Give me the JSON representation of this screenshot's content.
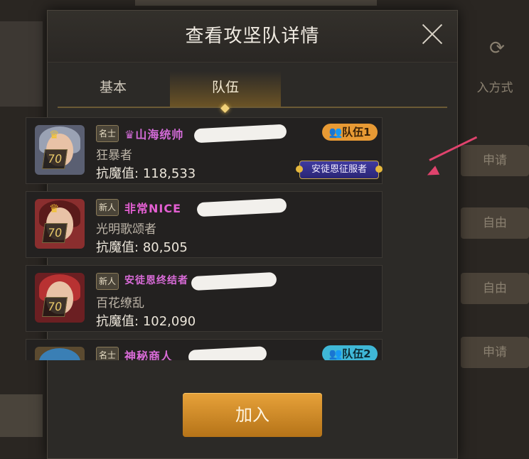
{
  "modal": {
    "title": "查看攻坚队详情",
    "tabs": [
      {
        "label": "基本",
        "active": false
      },
      {
        "label": "队伍",
        "active": true
      }
    ],
    "join_label": "加入"
  },
  "background": {
    "right_labels": [
      "入方式",
      "申请",
      "自由",
      "自由",
      "申请"
    ]
  },
  "members": [
    {
      "level": "70",
      "rank": "名士",
      "title": "山海统帅",
      "title_color": "#d36bd8",
      "job": "狂暴者",
      "power_label": "抗魔值:",
      "power": "118,533",
      "team_badge": "队伍1",
      "team_color": "#e89a34",
      "achievement": "安徒恩征服者",
      "avatar_hair": "#9aa2b4",
      "avatar_bg": "#5a5f72"
    },
    {
      "level": "70",
      "rank": "新人",
      "title": "非常NICE",
      "title_color": "#e35fd2",
      "job": "光明歌颂者",
      "power_label": "抗魔值:",
      "power": "80,505",
      "avatar_hair": "#5a1a1a",
      "avatar_bg": "#8a2e2e"
    },
    {
      "level": "70",
      "rank": "新人",
      "title": "安徒恩终结者",
      "title_color": "#d96bd8",
      "job": "百花缭乱",
      "power_label": "抗魔值:",
      "power": "102,090",
      "avatar_hair": "#b83232",
      "avatar_bg": "#6b1f22"
    },
    {
      "level": "",
      "rank": "名士",
      "title": "神秘商人",
      "title_color": "#d96bd8",
      "job": "",
      "power_label": "",
      "power": "",
      "team_badge": "队伍2",
      "team_color": "#3fb7d6",
      "avatar_hair": "#3a7fb5",
      "avatar_bg": "#5b4a30"
    }
  ]
}
